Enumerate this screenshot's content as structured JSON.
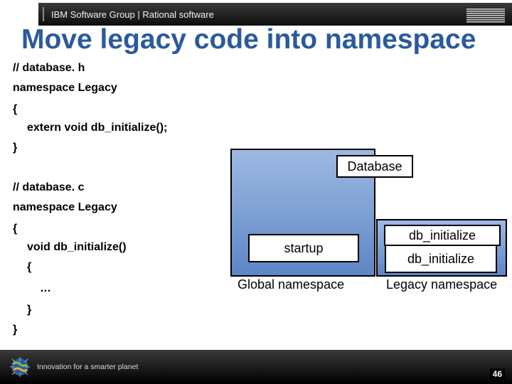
{
  "header": {
    "text": "IBM Software Group | Rational software",
    "logo_label": "IBM"
  },
  "title": "Move legacy code into namespace",
  "code": {
    "l1": "// database. h",
    "l2": "namespace Legacy",
    "l3": "{",
    "l4": "extern void db_initialize();",
    "l5": "}",
    "l6": "// database. c",
    "l7": "namespace Legacy",
    "l8": "{",
    "l9": "void db_initialize()",
    "l10": "{",
    "l11": "…",
    "l12": "}",
    "l13": "}"
  },
  "diagram": {
    "tab1": "Database",
    "box_startup": "startup",
    "tab2": "db_initialize",
    "box_dbinit": "db_initialize",
    "label_global": "Global namespace",
    "label_legacy": "Legacy namespace"
  },
  "footer": {
    "tagline": "Innovation for a smarter planet",
    "page": "46"
  }
}
